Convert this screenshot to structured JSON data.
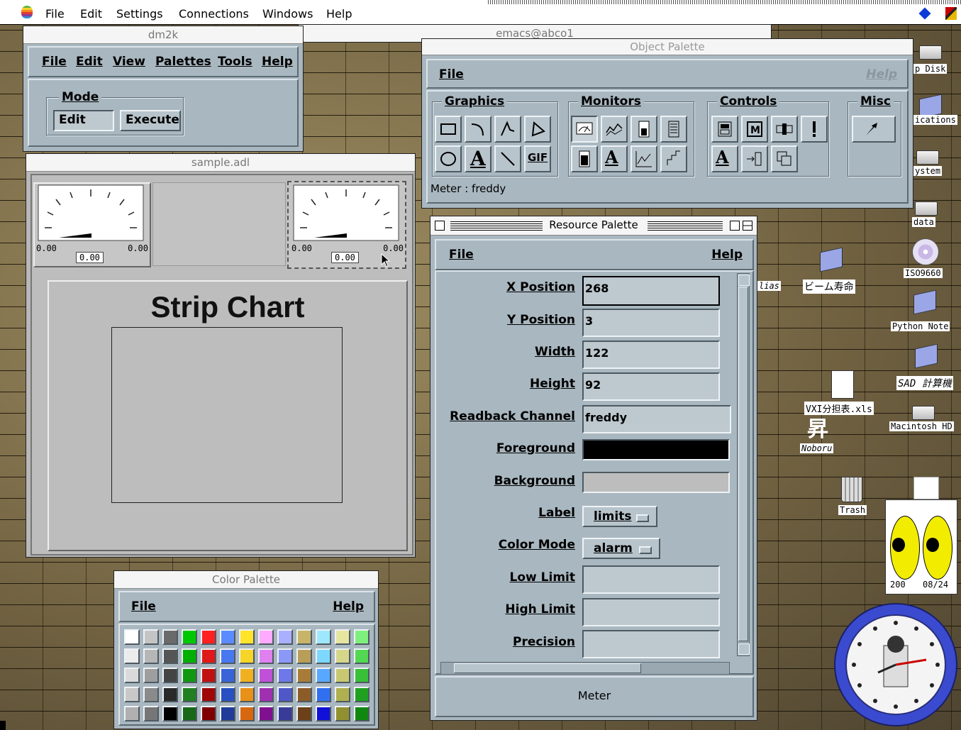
{
  "menubar": {
    "items": [
      "File",
      "Edit",
      "Settings",
      "Connections",
      "Windows",
      "Help"
    ]
  },
  "emacs": {
    "title": "emacs@abco1"
  },
  "dm2k": {
    "title": "dm2k",
    "menu": [
      "File",
      "Edit",
      "View",
      "Palettes",
      "Tools",
      "Help"
    ],
    "mode_label": "Mode",
    "edit_button": "Edit",
    "execute_button": "Execute"
  },
  "sample": {
    "title": "sample.adl",
    "meter_left": {
      "min": "0.00",
      "max": "0.00",
      "readout": "0.00",
      "level": 0
    },
    "meter_right": {
      "min": "0.00",
      "max": "0.00",
      "readout": "0.00",
      "level": 0
    },
    "strip_chart_title": "Strip Chart"
  },
  "object_palette": {
    "title": "Object Palette",
    "file": "File",
    "help": "Help",
    "groups": [
      "Graphics",
      "Monitors",
      "Controls",
      "Misc"
    ],
    "graphics_text_tool": "A",
    "graphics_gif_tool": "GIF",
    "status": "Meter : freddy"
  },
  "resource_palette": {
    "title": "Resource Palette",
    "file": "File",
    "help": "Help",
    "fields": {
      "x_position": {
        "label": "X Position",
        "value": "268"
      },
      "y_position": {
        "label": "Y Position",
        "value": "3"
      },
      "width": {
        "label": "Width",
        "value": "122"
      },
      "height": {
        "label": "Height",
        "value": "92"
      },
      "readback_channel": {
        "label": "Readback Channel",
        "value": "freddy"
      },
      "foreground": {
        "label": "Foreground",
        "color": "#000000"
      },
      "background": {
        "label": "Background",
        "color": "#bdbdbd"
      },
      "label": {
        "label": "Label",
        "value": "limits"
      },
      "color_mode": {
        "label": "Color Mode",
        "value": "alarm"
      },
      "low_limit": {
        "label": "Low Limit",
        "value": ""
      },
      "high_limit": {
        "label": "High Limit",
        "value": ""
      },
      "precision": {
        "label": "Precision",
        "value": ""
      }
    },
    "footer": "Meter"
  },
  "color_palette": {
    "title": "Color Palette",
    "file": "File",
    "help": "Help",
    "rows": [
      [
        "#ffffff",
        "#c4c4c4",
        "#6a6a6a",
        "#00c800",
        "#ff2020",
        "#5a8cff",
        "#ffe42a",
        "#ffaaff",
        "#aab0ff",
        "#c8b468",
        "#9ee8ff",
        "#e6e6a0",
        "#7ef07e"
      ],
      [
        "#ececec",
        "#b6b6b6",
        "#555555",
        "#00b000",
        "#e01818",
        "#4878f0",
        "#f6d428",
        "#e080f0",
        "#8c98f8",
        "#b89e58",
        "#7cd8ff",
        "#d6d68a",
        "#52d852"
      ],
      [
        "#dadada",
        "#9e9e9e",
        "#444444",
        "#109810",
        "#c01010",
        "#3864d8",
        "#f0b020",
        "#c050d8",
        "#6e78e8",
        "#a87c38",
        "#58a8ff",
        "#c8c870",
        "#38c038"
      ],
      [
        "#c8c8c8",
        "#8a8a8a",
        "#2a2a2a",
        "#208020",
        "#a00808",
        "#2850c0",
        "#e89018",
        "#a030b0",
        "#5058c8",
        "#8c5c28",
        "#3070f0",
        "#b0b050",
        "#20a020"
      ],
      [
        "#b0b0b0",
        "#767676",
        "#000000",
        "#186818",
        "#800000",
        "#203c98",
        "#d86810",
        "#801090",
        "#383c98",
        "#6c4018",
        "#1010d8",
        "#909030",
        "#108810"
      ]
    ]
  },
  "desktop": {
    "icons": [
      "p Disk",
      "ications",
      "ystem",
      "data",
      "ISO9660",
      "lias",
      "ビーム寿命",
      "Python Note",
      "SAD 計算機",
      "VXI分担表.xls",
      "Macintosh HD",
      "Noboru",
      "Trash"
    ],
    "noboru_glyph": "昇",
    "eyes_widget": {
      "left": "200",
      "right": "08/24"
    }
  }
}
